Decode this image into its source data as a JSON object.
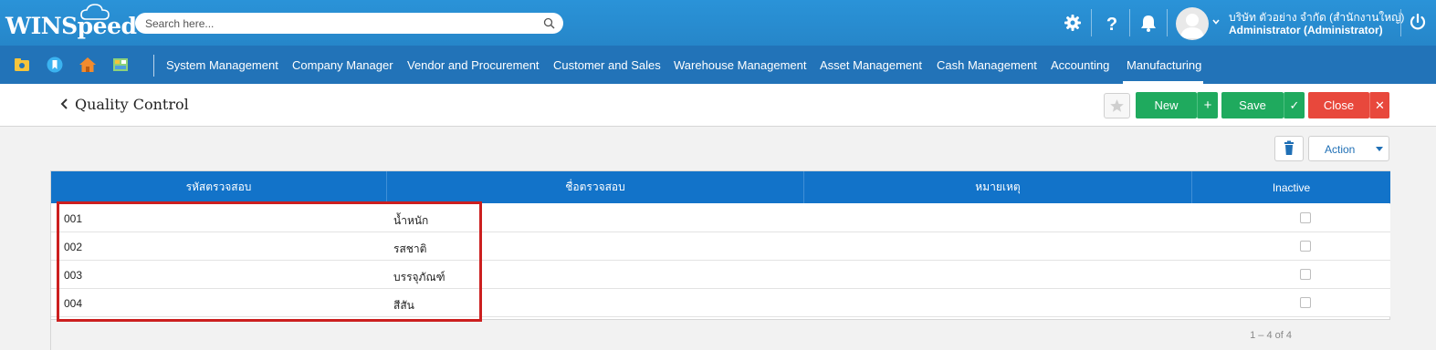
{
  "app": {
    "logo_text": "WINSpeed",
    "search_placeholder": "Search here..."
  },
  "user": {
    "company": "บริษัท ตัวอย่าง จำกัด (สำนักงานใหญ่)",
    "role": "Administrator (Administrator)"
  },
  "header_icons": [
    "settings-gear-icon",
    "help-question-icon",
    "notification-bell-icon",
    "avatar",
    "chevron-down-icon",
    "power-icon"
  ],
  "nav": {
    "quick_icons": [
      "folder-camera-icon",
      "bookmark-icon",
      "home-icon",
      "dashboard-icon"
    ],
    "items": [
      {
        "label": "System Management"
      },
      {
        "label": "Company Manager"
      },
      {
        "label": "Vendor and Procurement"
      },
      {
        "label": "Customer and Sales"
      },
      {
        "label": "Warehouse Management"
      },
      {
        "label": "Asset Management"
      },
      {
        "label": "Cash Management"
      },
      {
        "label": "Accounting"
      },
      {
        "label": "Manufacturing"
      }
    ],
    "active": "Manufacturing"
  },
  "page": {
    "title": "Quality Control",
    "buttons": {
      "new": "New",
      "new_plus": "+",
      "save": "Save",
      "save_check": "✓",
      "close": "Close",
      "close_x": "✕"
    },
    "action_label": "Action"
  },
  "grid": {
    "columns": [
      "รหัสตรวจสอบ",
      "ชื่อตรวจสอบ",
      "หมายเหตุ",
      "Inactive"
    ],
    "rows": [
      {
        "code": "001",
        "name": "น้ำหนัก",
        "note": "",
        "inactive": false
      },
      {
        "code": "002",
        "name": "รสชาติ",
        "note": "",
        "inactive": false
      },
      {
        "code": "003",
        "name": "บรรจุภัณฑ์",
        "note": "",
        "inactive": false
      },
      {
        "code": "004",
        "name": "สีสัน",
        "note": "",
        "inactive": false
      }
    ],
    "pager": "1 – 4 of 4"
  },
  "colors": {
    "header_blue": "#2a93d8",
    "nav_blue": "#2273b8",
    "grid_header": "#1273c9",
    "green": "#1faa5e",
    "red": "#e8483c",
    "highlight": "#cc1f1f"
  }
}
